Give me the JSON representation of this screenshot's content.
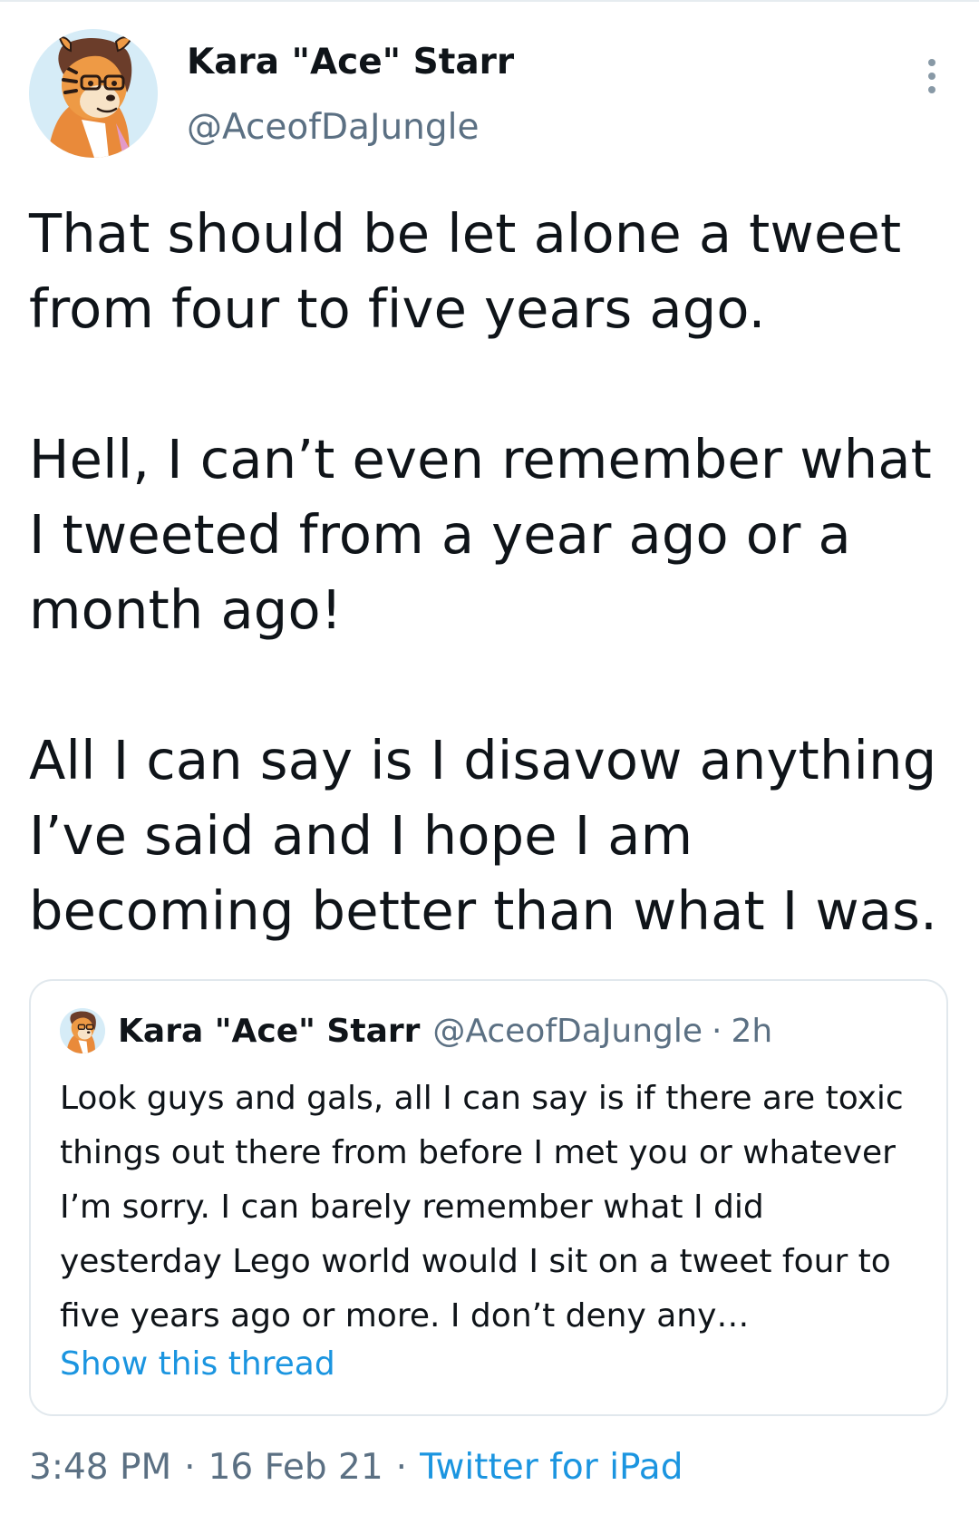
{
  "author": {
    "name": "Kara \"Ace\" Starr",
    "handle": "@AceofDaJungle",
    "avatar_icon": "tiger-character-avatar"
  },
  "more_icon": "vertical-ellipsis-icon",
  "tweet": {
    "paragraphs": [
      "That should be let alone a tweet from four to five years ago.",
      "Hell, I can’t even remember what I tweeted from a year ago or a month ago!",
      "All I can say is I disavow anything I’ve said and I hope I am becoming better than what I was."
    ]
  },
  "quoted_tweet": {
    "name": "Kara \"Ace\" Starr",
    "handle": "@AceofDaJungle",
    "separator": "·",
    "time": "2h",
    "text": "Look guys and gals, all I can say is if there are toxic things out there from before I met you or whatever I’m sorry. I can barely remember what I did yesterday Lego world would I sit on a tweet four to five years ago or more. I don’t deny any…",
    "show_thread": "Show this thread"
  },
  "meta": {
    "time": "3:48 PM",
    "separator": "·",
    "date": "16 Feb 21",
    "source": "Twitter for iPad"
  },
  "colors": {
    "text": "#0f1419",
    "secondary": "#5b7083",
    "link": "#1b95e0",
    "border": "#e1e8ed"
  }
}
